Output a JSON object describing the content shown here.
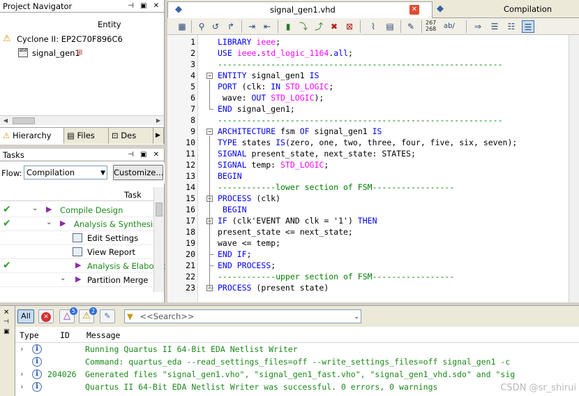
{
  "project_navigator": {
    "title": "Project Navigator",
    "entity_header": "Entity",
    "device": "Cyclone II: EP2C70F896C6",
    "entity": "signal_gen1",
    "tabs": [
      "Hierarchy",
      "Files",
      "Des"
    ]
  },
  "tasks": {
    "title": "Tasks",
    "flow_label": "Flow:",
    "flow_value": "Compilation",
    "customize_label": "Customize...",
    "task_header": "Task",
    "rows": [
      {
        "label": "Compile Design",
        "checked": true
      },
      {
        "label": "Analysis & Synthesis",
        "checked": true
      },
      {
        "label": "Edit Settings",
        "checked": false
      },
      {
        "label": "View Report",
        "checked": false
      },
      {
        "label": "Analysis & Elaborat",
        "checked": true
      },
      {
        "label": "Partition Merge",
        "checked": false
      }
    ]
  },
  "editor": {
    "file_tab": "signal_gen1.vhd",
    "report_tab": "Compilation Report - s",
    "toolbar_numbers": "267\n268",
    "toolbar_abc": "ab/",
    "lines": [
      {
        "n": "1",
        "code": "LIBRARY ieee;"
      },
      {
        "n": "2",
        "code": "USE ieee.std_logic_1164.all;"
      },
      {
        "n": "3",
        "code": "-----------------------------------------------------------"
      },
      {
        "n": "4",
        "code": "ENTITY signal_gen1 IS"
      },
      {
        "n": "5",
        "code": "PORT (clk: IN STD_LOGIC;"
      },
      {
        "n": "6",
        "code": " wave: OUT STD_LOGIC);"
      },
      {
        "n": "7",
        "code": "END signal_gen1;"
      },
      {
        "n": "8",
        "code": "-----------------------------------------------------------"
      },
      {
        "n": "9",
        "code": "ARCHITECTURE fsm OF signal_gen1 IS"
      },
      {
        "n": "10",
        "code": "TYPE states IS(zero, one, two, three, four, five, six, seven);"
      },
      {
        "n": "11",
        "code": "SIGNAL present_state, next_state: STATES;"
      },
      {
        "n": "12",
        "code": "SIGNAL temp: STD_LOGIC;"
      },
      {
        "n": "13",
        "code": "BEGIN"
      },
      {
        "n": "14",
        "code": "------------lower section of FSM-----------------"
      },
      {
        "n": "15",
        "code": "PROCESS (clk)"
      },
      {
        "n": "16",
        "code": " BEGIN"
      },
      {
        "n": "17",
        "code": "IF (clk'EVENT AND clk = '1') THEN"
      },
      {
        "n": "18",
        "code": "present_state <= next_state;"
      },
      {
        "n": "19",
        "code": "wave <= temp;"
      },
      {
        "n": "20",
        "code": "END IF;"
      },
      {
        "n": "21",
        "code": "END PROCESS;"
      },
      {
        "n": "22",
        "code": "------------upper section of FSM-----------------"
      },
      {
        "n": "23",
        "code": "PROCESS (present state)"
      }
    ]
  },
  "messages": {
    "all_label": "All",
    "badge_suppressed": "5",
    "badge_warning": "2",
    "search_placeholder": "<<Search>>",
    "col_type": "Type",
    "col_id": "ID",
    "col_message": "Message",
    "rows": [
      {
        "id": "",
        "text": "Running Quartus II 64-Bit EDA Netlist Writer"
      },
      {
        "id": "",
        "text": "Command: quartus_eda --read_settings_files=off --write_settings_files=off signal_gen1 -c"
      },
      {
        "id": "204026",
        "text": "Generated files \"signal_gen1.vho\", \"signal_gen1_fast.vho\", \"signal_gen1_vhd.sdo\" and \"sig"
      },
      {
        "id": "",
        "text": "Quartus II 64-Bit EDA Netlist Writer was successful. 0 errors, 0 warnings"
      }
    ]
  },
  "watermark": "CSDN @sr_shirui",
  "colors": {
    "keyword": "#0000ff",
    "type": "#ff00ff",
    "comment": "#008000",
    "message_text": "#1a8a1a"
  }
}
